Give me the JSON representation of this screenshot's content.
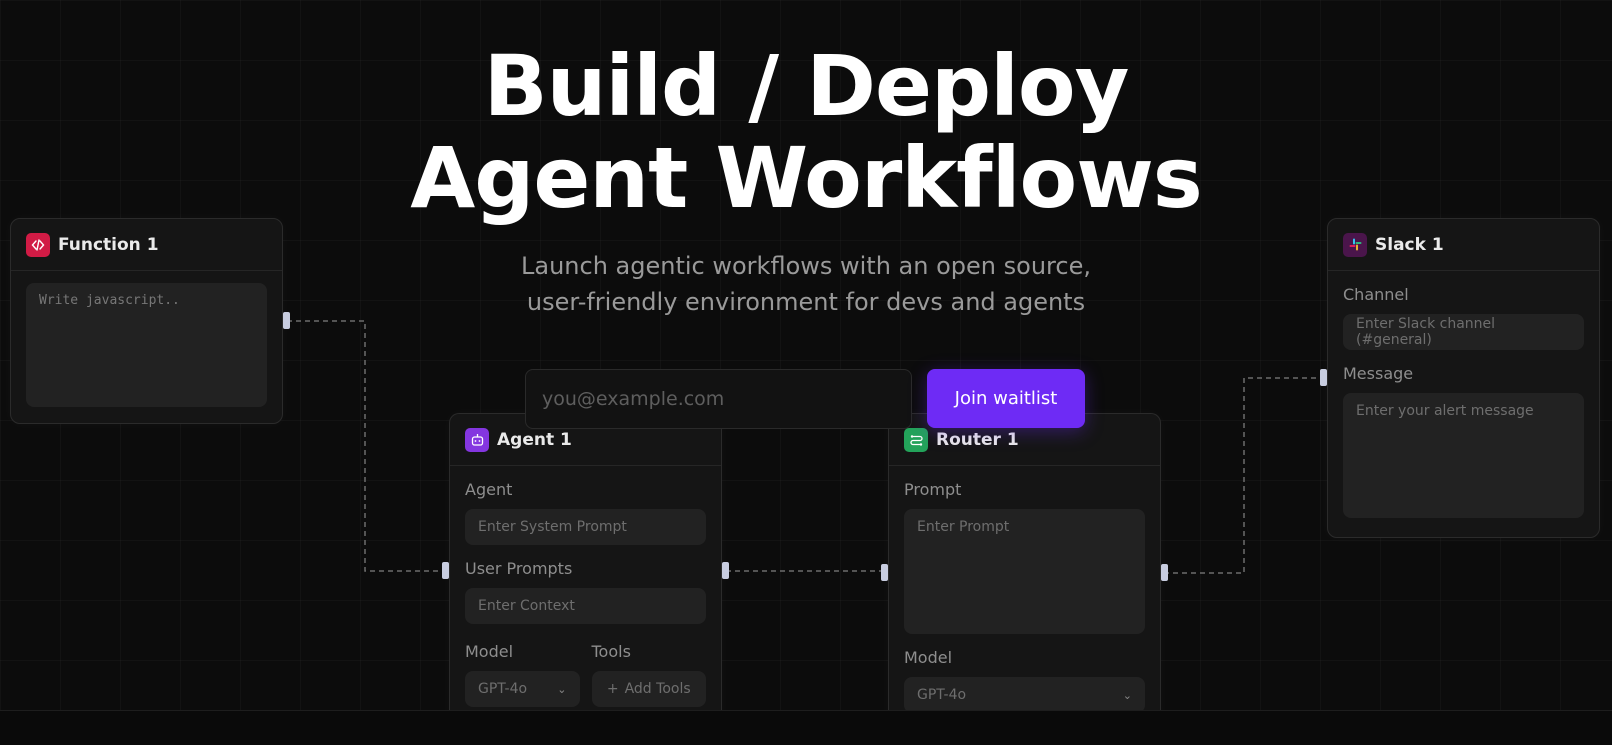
{
  "hero": {
    "title_line1": "Build / Deploy",
    "title_line2": "Agent Workflows",
    "subtitle_line1": "Launch agentic workflows with an open source,",
    "subtitle_line2": "user-friendly environment for devs and agents"
  },
  "waitlist": {
    "email_placeholder": "you@example.com",
    "button_label": "Join waitlist"
  },
  "nodes": {
    "function": {
      "title": "Function 1",
      "code_placeholder": "Write javascript..",
      "icon": "code-icon",
      "icon_color": "#d11b45"
    },
    "agent": {
      "title": "Agent 1",
      "icon": "robot-icon",
      "icon_color": "#8436e0",
      "agent_label": "Agent",
      "agent_placeholder": "Enter System Prompt",
      "user_prompts_label": "User Prompts",
      "context_placeholder": "Enter Context",
      "model_label": "Model",
      "model_value": "GPT-4o",
      "tools_label": "Tools",
      "add_tools_label": "Add Tools"
    },
    "router": {
      "title": "Router 1",
      "icon": "route-icon",
      "icon_color": "#23a35a",
      "prompt_label": "Prompt",
      "prompt_placeholder": "Enter Prompt",
      "model_label": "Model",
      "model_value": "GPT-4o"
    },
    "slack": {
      "title": "Slack 1",
      "icon": "slack-icon",
      "icon_color": "#4a154b",
      "channel_label": "Channel",
      "channel_placeholder": "Enter Slack channel (#general)",
      "message_label": "Message",
      "message_placeholder": "Enter your alert message"
    }
  }
}
